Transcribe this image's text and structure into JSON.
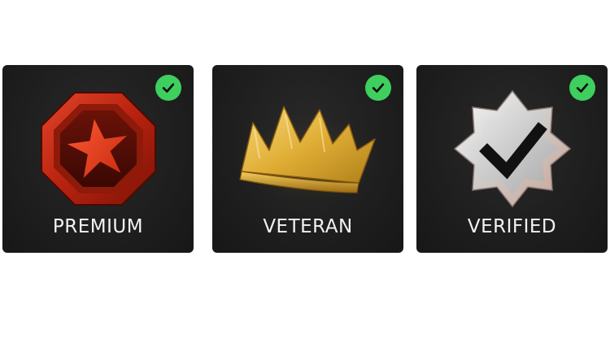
{
  "badges": [
    {
      "label": "PREMIUM",
      "icon": "red-octagon-star-icon",
      "checked": true,
      "accent": "#c0280f"
    },
    {
      "label": "VETERAN",
      "icon": "gold-crown-icon",
      "checked": true,
      "accent": "#e2b23a"
    },
    {
      "label": "VERIFIED",
      "icon": "silver-star-check-icon",
      "checked": true,
      "accent": "#cfcfcf"
    }
  ],
  "colors": {
    "check": "#3ecf5e",
    "card_bg": "#1f1f1f",
    "label_text": "#f2f2f2"
  }
}
